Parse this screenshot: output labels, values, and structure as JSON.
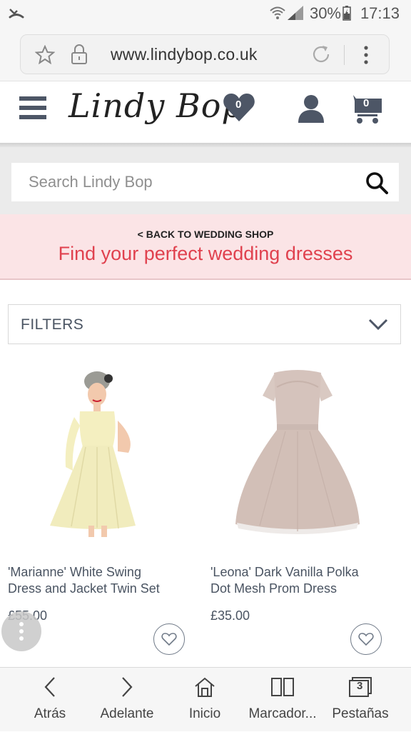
{
  "status_bar": {
    "battery_percent": "30%",
    "time": "17:13"
  },
  "browser": {
    "url": "www.lindybop.co.uk"
  },
  "header": {
    "logo_text": "Lindy Bop",
    "wishlist_count": "0",
    "cart_count": "0"
  },
  "search": {
    "placeholder": "Search Lindy Bop"
  },
  "banner": {
    "back_link": "< BACK TO WEDDING SHOP",
    "title": "Find your perfect wedding dresses"
  },
  "filters": {
    "label": "FILTERS"
  },
  "products": [
    {
      "name_line1": "'Marianne' White Swing",
      "name_line2": "Dress and Jacket Twin Set",
      "price": "£55.00"
    },
    {
      "name_line1": "'Leona' Dark Vanilla Polka",
      "name_line2": "Dot Mesh Prom Dress",
      "price": "£35.00"
    }
  ],
  "bottom_nav": {
    "back": "Atrás",
    "forward": "Adelante",
    "home": "Inicio",
    "bookmarks": "Marcador...",
    "tabs": "Pestañas",
    "tabs_count": "3"
  },
  "colors": {
    "accent_red": "#e0414e",
    "banner_bg": "#fbe4e6",
    "icon_slate": "#4d5666"
  }
}
